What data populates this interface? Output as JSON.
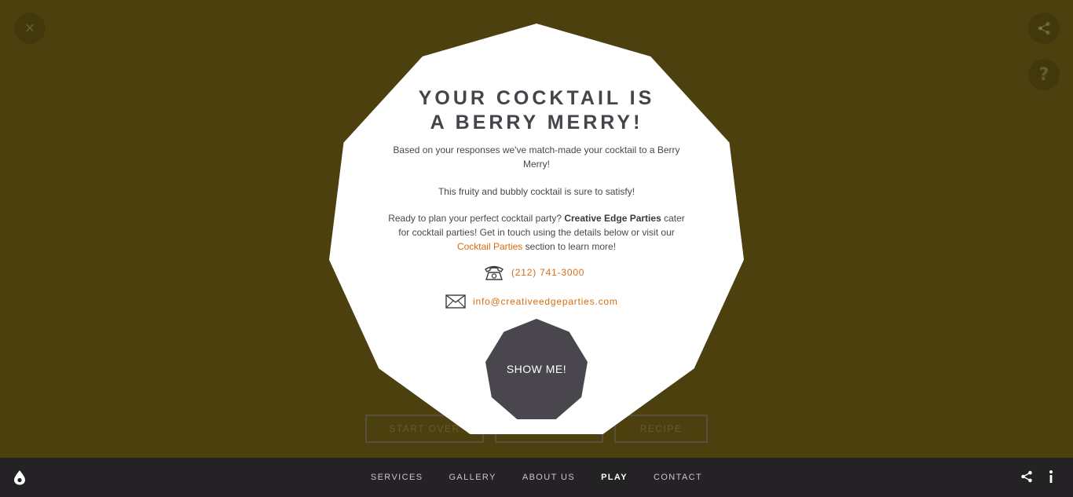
{
  "overlay": {
    "close_icon": "×",
    "help_icon": "?",
    "bottom_buttons": {
      "start_over": "START OVER",
      "middle": "",
      "recipe": "RECIPE"
    }
  },
  "result": {
    "title_line1": "YOUR COCKTAIL IS",
    "title_line2": "A BERRY MERRY!",
    "intro": "Based on your responses we've match-made your cocktail to a Berry Merry!",
    "subtext": "This fruity and bubbly cocktail is sure to satisfy!",
    "cta_part1": "Ready to plan your perfect cocktail party?",
    "cta_brand": "Creative Edge Parties",
    "cta_part2": "cater for cocktail parties! Get in touch using the details below or visit our",
    "cta_link": "Cocktail Parties",
    "cta_part3": "section to learn more!",
    "phone": "(212) 741-3000",
    "email": "info@creativeedgeparties.com",
    "show_button": "SHOW ME!"
  },
  "footer": {
    "nav": [
      {
        "label": "SERVICES",
        "active": false
      },
      {
        "label": "GALLERY",
        "active": false
      },
      {
        "label": "ABOUT US",
        "active": false
      },
      {
        "label": "PLAY",
        "active": true
      },
      {
        "label": "CONTACT",
        "active": false
      }
    ]
  },
  "icons": {
    "close": "close-icon",
    "share": "share-icon",
    "help": "help-icon",
    "phone": "phone-icon",
    "email": "envelope-icon",
    "logo": "logo-icon",
    "info": "info-icon"
  },
  "colors": {
    "background": "#4c400e",
    "card": "#ffffff",
    "accent": "#d86d10",
    "dark": "#4a464e",
    "footer": "#252225"
  }
}
